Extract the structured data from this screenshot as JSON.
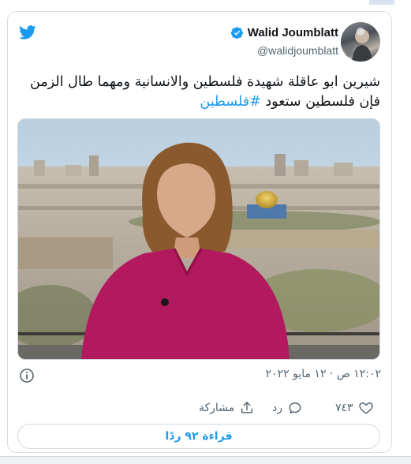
{
  "tweet": {
    "display_name": "Walid Joumblatt",
    "handle": "@walidjoumblatt",
    "text_main": "شيرين ابو عاقلة شهيدة فلسطين والانسانية ومهما طال الزمن فإن فلسطين ستعود ",
    "hashtag": "#فلسطين",
    "timestamp": "١٢:٠٢ ص · ١٢ مايو ٢٠٢٢",
    "likes": "٧٤٣",
    "reply_label": "رد",
    "share_label": "مشاركة",
    "read_replies_label": "قراءة ٩٢ ردًا"
  },
  "icons": {
    "brand": "twitter-bird-icon",
    "verified": "verified-badge-icon",
    "info": "info-icon",
    "like": "heart-icon",
    "reply": "reply-bubble-icon",
    "share": "share-upload-icon"
  },
  "colors": {
    "accent": "#1d9bf0",
    "text": "#0f1419",
    "muted": "#536471",
    "border": "#cfd9de"
  }
}
